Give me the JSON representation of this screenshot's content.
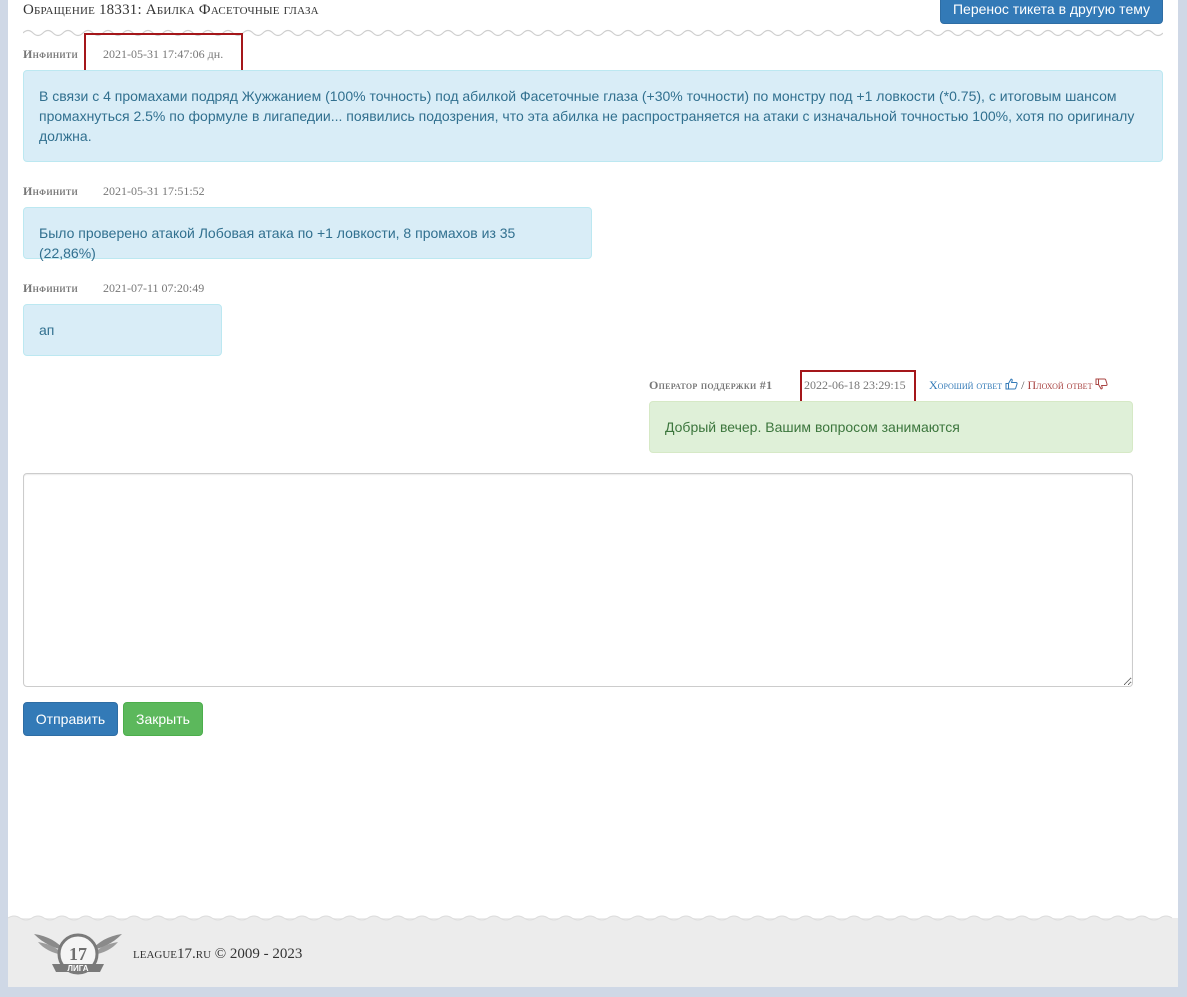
{
  "ticket": {
    "title": "Обращение 18331: Абилка Фасеточные глаза",
    "move_button": "Перенос тикета в другую тему"
  },
  "messages": [
    {
      "author": "Инфинити",
      "time": "2021-05-31 17:47:06 дн.",
      "text": "В связи с 4 промахами подряд Жужжанием (100% точность) под абилкой Фасеточные глаза (+30% точности) по монстру под +1 ловкости (*0.75), с итоговым шансом промахнуться 2.5% по формуле в лигапедии... появились подозрения, что эта абилка не распространяется на атаки с изначальной точностью 100%, хотя по оригиналу должна."
    },
    {
      "author": "Инфинити",
      "time": "2021-05-31 17:51:52",
      "text": "Было проверено атакой Лобовая атака по +1 ловкости, 8 промахов из 35 (22,86%)"
    },
    {
      "author": "Инфинити",
      "time": "2021-07-11 07:20:49",
      "text": "ап"
    }
  ],
  "operator_reply": {
    "author": "Оператор поддержки #1",
    "time": "2022-06-18 23:29:15",
    "good_label": "Хороший ответ",
    "separator": "/",
    "bad_label": "Плохой ответ",
    "text": "Добрый вечер. Вашим вопросом занимаются"
  },
  "reply_form": {
    "value": "",
    "send_label": "Отправить",
    "close_label": "Закрыть"
  },
  "footer": {
    "copyright": "league17.ru © 2009 - 2023",
    "logo_number": "17",
    "logo_word": "ЛИГА"
  },
  "colors": {
    "primary": "#337ab7",
    "success": "#5cb85c",
    "info_bg": "#d9edf7",
    "success_bg": "#dff0d8",
    "highlight": "#a4161a"
  }
}
